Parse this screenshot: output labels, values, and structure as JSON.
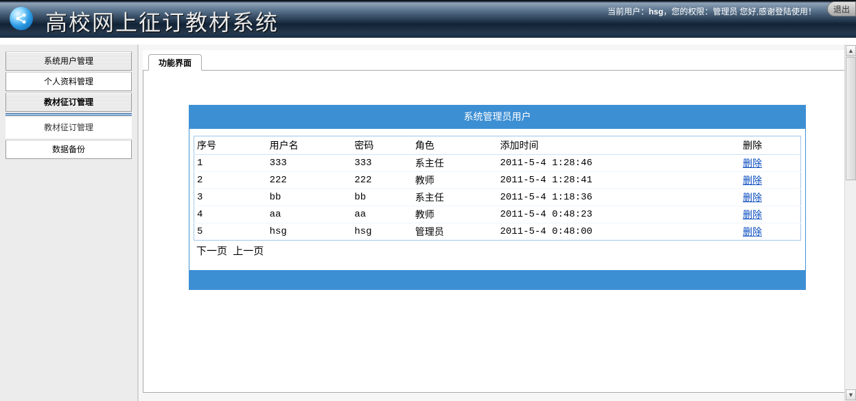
{
  "header": {
    "title": "高校网上征订教材系统",
    "userbar_prefix": "当前用户：",
    "username": "hsg",
    "userbar_mid": "，您的权限：",
    "role": "管理员",
    "userbar_suffix": " 您好,感谢登陆使用！",
    "logout": "退出"
  },
  "sidebar": {
    "items": [
      {
        "label": "系统用户管理",
        "style": "hatched"
      },
      {
        "label": "个人资料管理",
        "style": "plain"
      },
      {
        "label": "教材征订管理",
        "style": "hatched active"
      }
    ],
    "sub_item": {
      "label": "教材征订管理"
    },
    "tail": {
      "label": "数据备份",
      "style": "plain"
    }
  },
  "tab": {
    "label": "功能界面"
  },
  "panel": {
    "title": "系统管理员用户",
    "columns": {
      "id": "序号",
      "username": "用户名",
      "password": "密码",
      "role": "角色",
      "created": "添加时间",
      "action": "删除"
    },
    "action_label": "删除",
    "rows": [
      {
        "id": "1",
        "username": "333",
        "password": "333",
        "role": "系主任",
        "created": "2011-5-4 1:28:46"
      },
      {
        "id": "2",
        "username": "222",
        "password": "222",
        "role": "教师",
        "created": "2011-5-4 1:28:41"
      },
      {
        "id": "3",
        "username": "bb",
        "password": "bb",
        "role": "系主任",
        "created": "2011-5-4 1:18:36"
      },
      {
        "id": "4",
        "username": "aa",
        "password": "aa",
        "role": "教师",
        "created": "2011-5-4 0:48:23"
      },
      {
        "id": "5",
        "username": "hsg",
        "password": "hsg",
        "role": "管理员",
        "created": "2011-5-4 0:48:00"
      }
    ],
    "pager": {
      "next": "下一页",
      "prev": "上一页"
    }
  }
}
